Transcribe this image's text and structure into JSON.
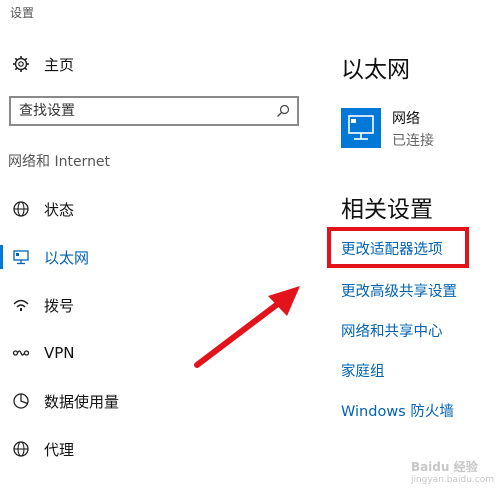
{
  "window": {
    "title": "设置"
  },
  "sidebar": {
    "home_label": "主页",
    "search_placeholder": "查找设置",
    "section_label": "网络和 Internet",
    "items": [
      {
        "label": "状态",
        "icon": "globe-icon"
      },
      {
        "label": "以太网",
        "icon": "ethernet-icon",
        "selected": true
      },
      {
        "label": "拨号",
        "icon": "dialup-icon"
      },
      {
        "label": "VPN",
        "icon": "vpn-icon"
      },
      {
        "label": "数据使用量",
        "icon": "data-usage-icon"
      },
      {
        "label": "代理",
        "icon": "globe-icon"
      }
    ]
  },
  "main": {
    "heading": "以太网",
    "network": {
      "name": "网络",
      "status": "已连接",
      "icon": "monitor-icon"
    },
    "related_heading": "相关设置",
    "links": [
      "更改适配器选项",
      "更改高级共享设置",
      "网络和共享中心",
      "家庭组",
      "Windows 防火墙"
    ]
  },
  "colors": {
    "accent": "#0078d7",
    "link": "#0063b1",
    "annotation_red": "#e3131b"
  },
  "watermark": {
    "brand": "Baidu 经验",
    "url": "jingyan.baidu.com"
  }
}
